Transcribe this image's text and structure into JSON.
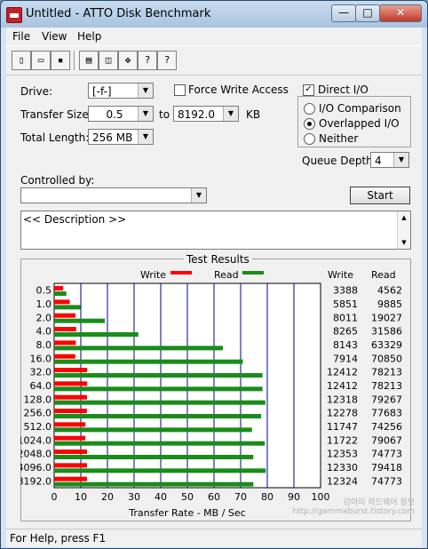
{
  "window": {
    "title": "Untitled - ATTO Disk Benchmark",
    "minimize": "—",
    "maximize": "□",
    "close": "✕"
  },
  "menu": [
    "File",
    "View",
    "Help"
  ],
  "toolbar": [
    "new",
    "open",
    "save",
    "print",
    "print-preview",
    "move",
    "help",
    "context-help"
  ],
  "toolbar_glyphs": [
    "▯",
    "▭",
    "▪",
    "▤",
    "◫",
    "✥",
    "?",
    "?"
  ],
  "settings": {
    "drive_label": "Drive:",
    "drive_value": "[-f-]",
    "force_write_label": "Force Write Access",
    "force_write_checked": false,
    "direct_io_label": "Direct I/O",
    "direct_io_checked": true,
    "transfer_size_label": "Transfer Size:",
    "transfer_from": "0.5",
    "transfer_to_label": "to",
    "transfer_to": "8192.0",
    "transfer_unit": "KB",
    "total_length_label": "Total Length:",
    "total_length": "256 MB",
    "io_comparison": "I/O Comparison",
    "overlapped_io": "Overlapped I/O",
    "neither": "Neither",
    "selected_mode": "overlapped",
    "queue_depth_label": "Queue Depth:",
    "queue_depth": "4",
    "controlled_by_label": "Controlled by:",
    "controlled_by": "",
    "start_label": "Start",
    "description": "<< Description >>"
  },
  "results_title": "Test Results",
  "legend": {
    "write": "Write",
    "read": "Read"
  },
  "col_headers": {
    "write": "Write",
    "read": "Read"
  },
  "colors": {
    "write": "#ff0000",
    "read": "#1a8c1a",
    "grid": "#00008b"
  },
  "status": "For Help, press F1",
  "watermark": "감마의 하드웨어 정보 http://gammaburst.tistory.com",
  "chart_data": {
    "type": "bar",
    "orientation": "horizontal",
    "categories": [
      "0.5",
      "1.0",
      "2.0",
      "4.0",
      "8.0",
      "16.0",
      "32.0",
      "64.0",
      "128.0",
      "256.0",
      "512.0",
      "1024.0",
      "2048.0",
      "4096.0",
      "8192.0"
    ],
    "series": [
      {
        "name": "Write",
        "values": [
          3388,
          5851,
          8011,
          8265,
          8143,
          7914,
          12412,
          12412,
          12318,
          12278,
          11747,
          11722,
          12353,
          12330,
          12324
        ]
      },
      {
        "name": "Read",
        "values": [
          4562,
          9885,
          19027,
          31586,
          63329,
          70850,
          78213,
          78213,
          79267,
          77683,
          74256,
          79067,
          74773,
          79418,
          74773
        ]
      }
    ],
    "xlabel": "Transfer Rate - MB / Sec",
    "xticks": [
      "0",
      "10",
      "20",
      "30",
      "40",
      "50",
      "60",
      "70",
      "80",
      "90",
      "100"
    ],
    "xlim": [
      0,
      100
    ],
    "value_unit_per_mb": 1000,
    "grid": true
  }
}
